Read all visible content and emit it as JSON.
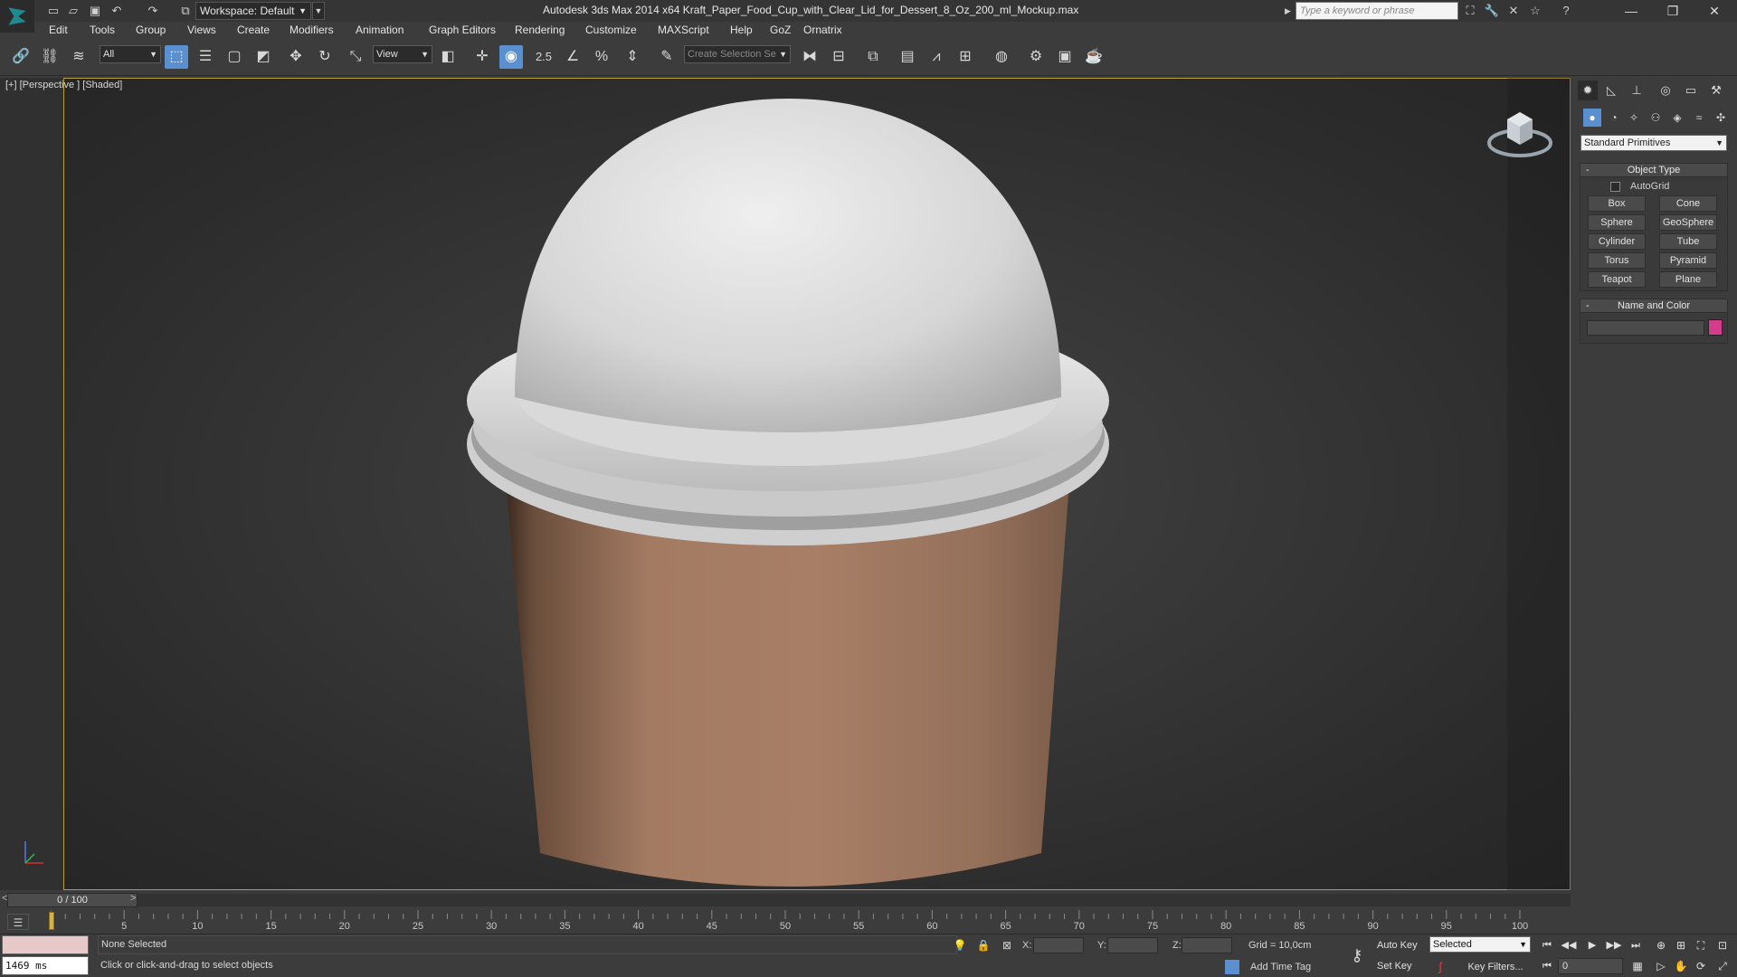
{
  "title_bar": {
    "workspace_label": "Workspace: Default",
    "app_title": "Autodesk 3ds Max  2014 x64     Kraft_Paper_Food_Cup_with_Clear_Lid_for_Dessert_8_Oz_200_ml_Mockup.max",
    "search_placeholder": "Type a keyword or phrase",
    "quick_access_icons": [
      "new-icon",
      "open-icon",
      "save-icon",
      "undo-icon",
      "redo-icon",
      "project-icon"
    ]
  },
  "menu": {
    "items": [
      "Edit",
      "Tools",
      "Group",
      "Views",
      "Create",
      "Modifiers",
      "Animation",
      "Graph Editors",
      "Rendering",
      "Customize",
      "MAXScript",
      "Help",
      "GoZ",
      "Ornatrix"
    ]
  },
  "toolbar": {
    "selection_filter": "All",
    "ref_coord": "View",
    "snaps_value": "2.5",
    "named_selection": "Create Selection Se"
  },
  "viewport": {
    "label": "[+] [Perspective ] [Shaded]",
    "accent_color": "#b89b3a"
  },
  "command_panel": {
    "category_dropdown": "Standard Primitives",
    "object_type_title": "Object Type",
    "autogrid_label": "AutoGrid",
    "primitives": [
      "Box",
      "Cone",
      "Sphere",
      "GeoSphere",
      "Cylinder",
      "Tube",
      "Torus",
      "Pyramid",
      "Teapot",
      "Plane"
    ],
    "name_color_title": "Name and Color",
    "swatch_color": "#d63c8e"
  },
  "time_slider": {
    "position_text": "0 / 100",
    "left_arrow": "<",
    "right_arrow": ">",
    "ticks": [
      "5",
      "10",
      "15",
      "20",
      "25",
      "30",
      "35",
      "40",
      "45",
      "50",
      "55",
      "60",
      "65",
      "70",
      "75",
      "80",
      "85",
      "90",
      "95",
      "100"
    ]
  },
  "status": {
    "selection": "None Selected",
    "prompt": "Click or click-and-drag to select objects",
    "render_time": "1469 ms",
    "x_label": "X:",
    "y_label": "Y:",
    "z_label": "Z:",
    "grid": "Grid = 10,0cm",
    "add_time_tag": "Add Time Tag",
    "auto_key": "Auto Key",
    "set_key": "Set Key",
    "selected_dropdown": "Selected",
    "key_filters": "Key Filters...",
    "frame_value": "0"
  }
}
